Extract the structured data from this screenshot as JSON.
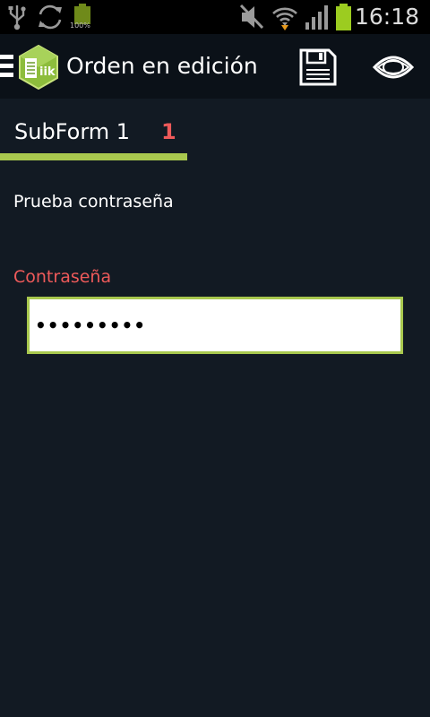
{
  "status_bar": {
    "time": "16:18",
    "battery_text": "100%",
    "icons": [
      "usb-icon",
      "sync-icon",
      "battery-full-icon",
      "mute-icon",
      "wifi-icon",
      "signal-icon",
      "battery-icon"
    ]
  },
  "action_bar": {
    "title": "Orden en edición",
    "logo_text": "iik",
    "icons": [
      "menu-icon",
      "app-logo-icon",
      "save-icon",
      "eye-icon"
    ]
  },
  "tabs": [
    {
      "label": "SubForm 1",
      "count": "1",
      "selected": true
    }
  ],
  "form": {
    "title": "Prueba contraseña",
    "password_label": "Contraseña",
    "password_value": "•••••••••"
  },
  "colors": {
    "background": "#121a23",
    "action_bar": "#0b1118",
    "accent": "#a8c84e",
    "error": "#ee5a5a"
  }
}
